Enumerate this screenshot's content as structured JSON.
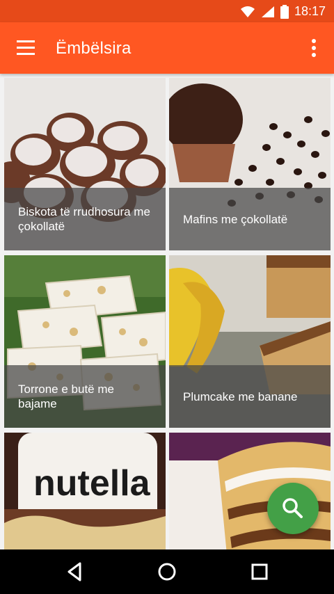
{
  "status_bar": {
    "time": "18:17"
  },
  "app_bar": {
    "title": "Ëmbëlsira"
  },
  "recipes": [
    {
      "caption": "Biskota të rrudhosura me çokollatë"
    },
    {
      "caption": "Mafins me çokollatë"
    },
    {
      "caption": "Torrone e butë me bajame"
    },
    {
      "caption": "Plumcake me banane"
    },
    {
      "caption": ""
    },
    {
      "caption": ""
    }
  ],
  "photo_text": {
    "nutella": "nutella"
  },
  "colors": {
    "status_bar": "#e64a19",
    "app_bar": "#ff5722",
    "fab": "#43a047"
  },
  "icons": [
    "menu-icon",
    "more-vert-icon",
    "search-icon",
    "back-icon",
    "home-icon",
    "recents-icon",
    "wifi-icon",
    "signal-icon",
    "battery-icon"
  ]
}
